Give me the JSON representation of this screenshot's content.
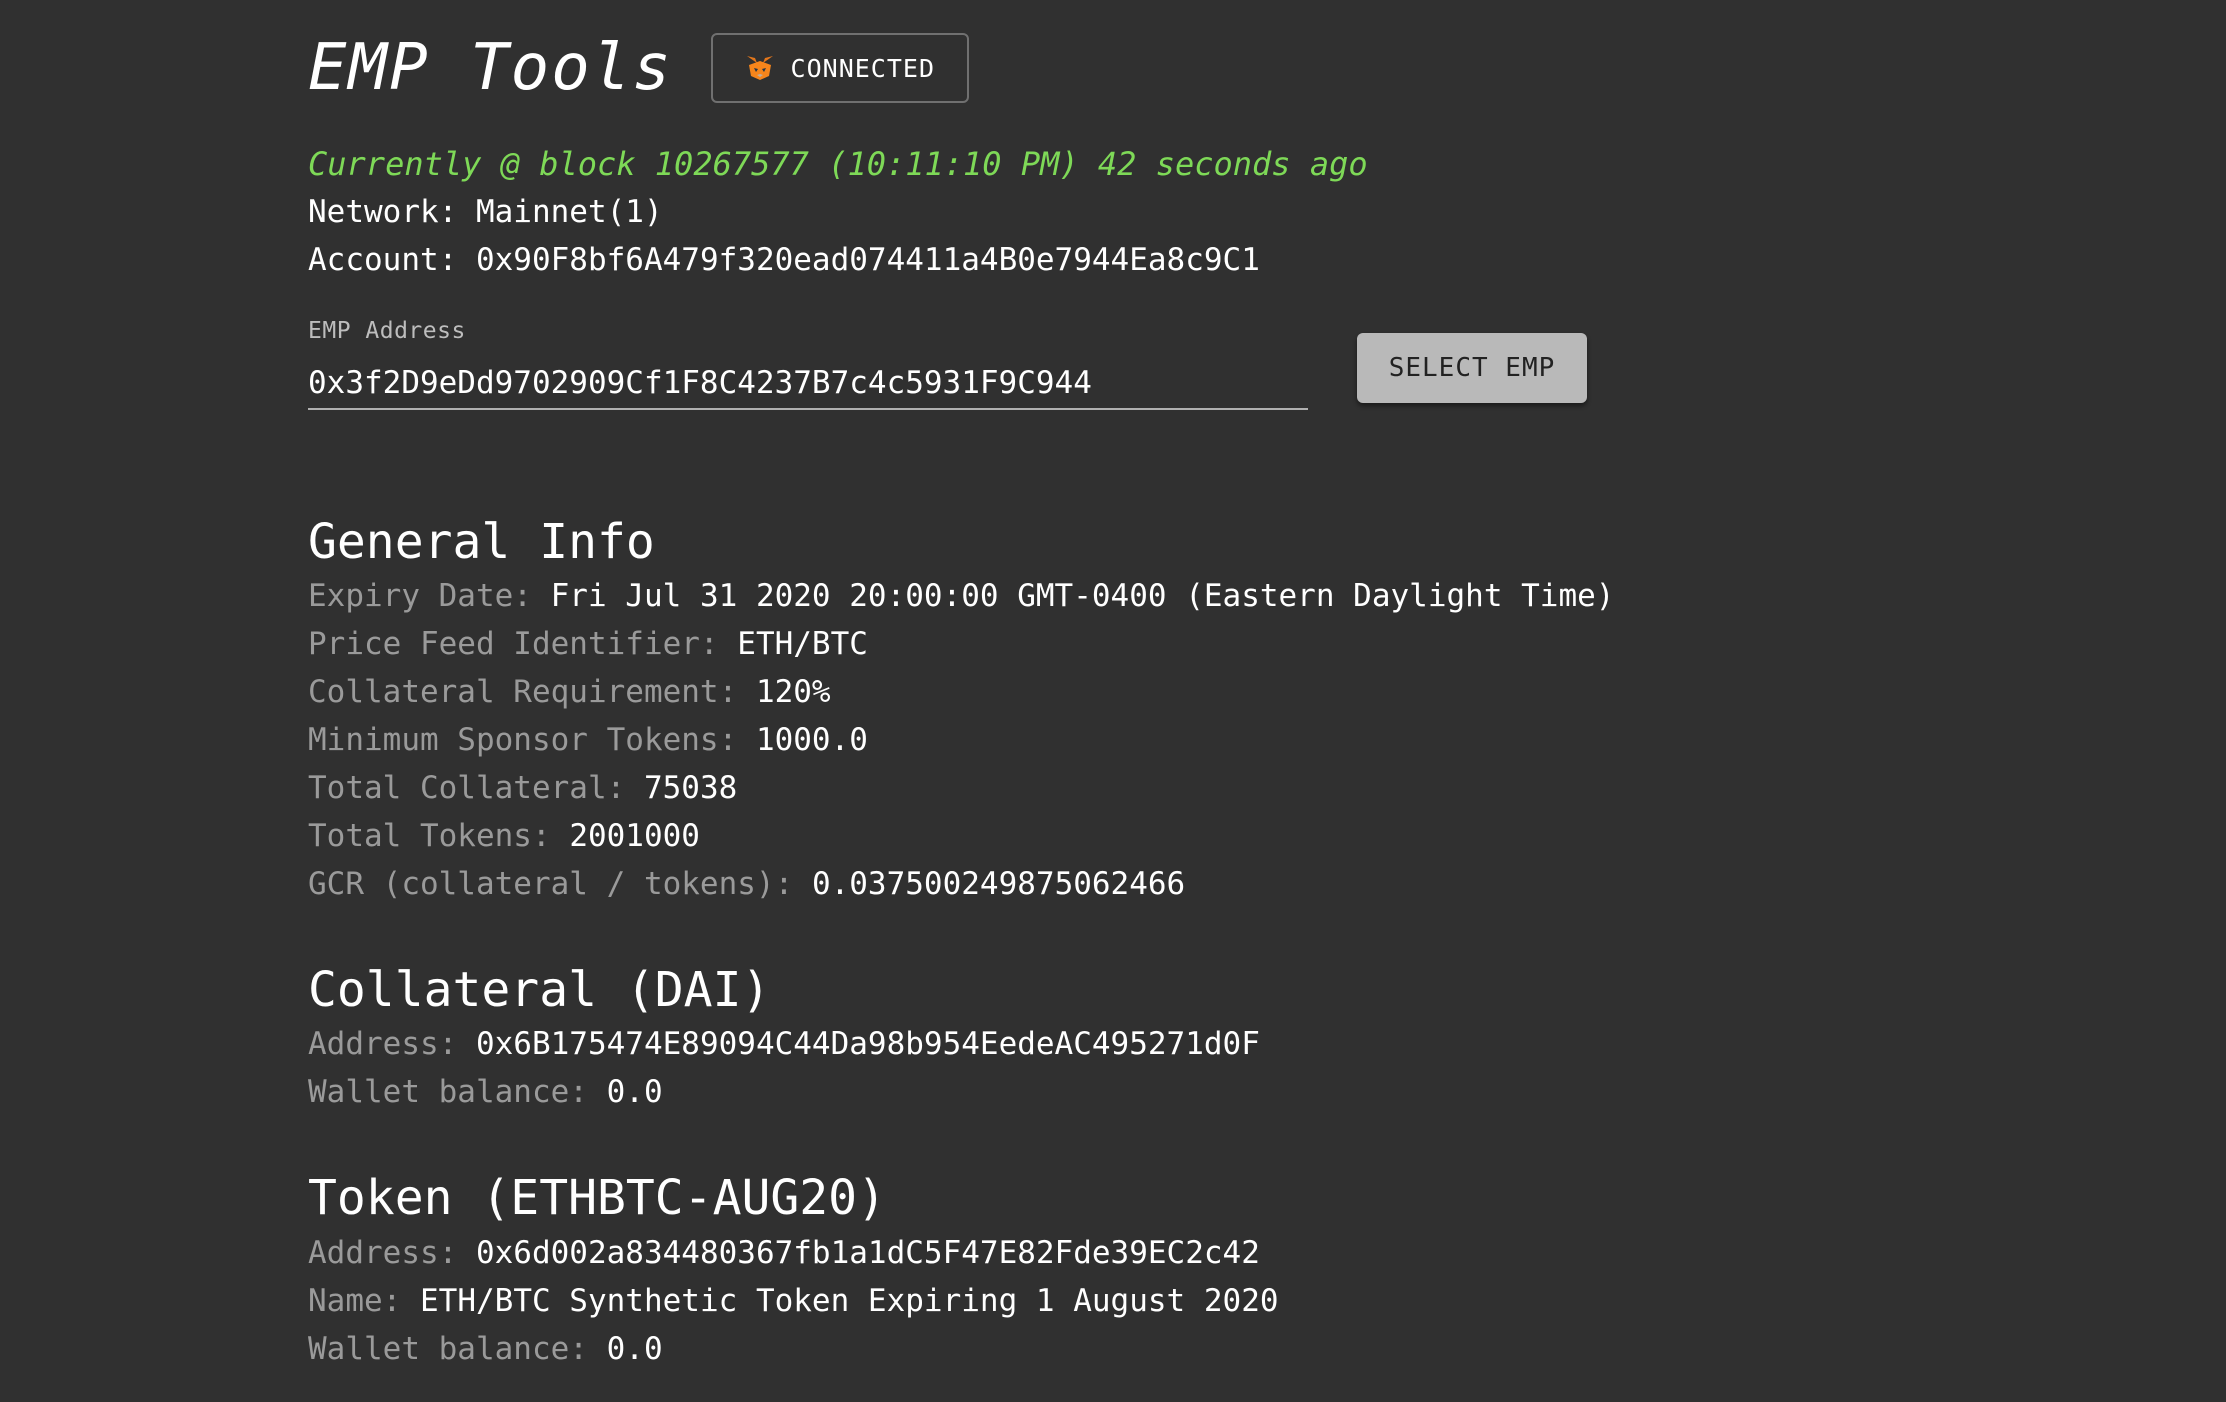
{
  "header": {
    "title": "EMP Tools",
    "connected_label": "CONNECTED"
  },
  "status": {
    "block_line": "Currently @ block 10267577 (10:11:10 PM) 42 seconds ago",
    "network_label": "Network:",
    "network_value": "Mainnet(1)",
    "account_label": "Account:",
    "account_value": "0x90F8bf6A479f320ead074411a4B0e7944Ea8c9C1"
  },
  "emp_selector": {
    "label": "EMP Address",
    "value": "0x3f2D9eDd9702909Cf1F8C4237B7c4c5931F9C944",
    "button_label": "SELECT EMP"
  },
  "general_info": {
    "heading": "General Info",
    "rows": [
      {
        "label": "Expiry Date:",
        "value": "Fri Jul 31 2020 20:00:00 GMT-0400 (Eastern Daylight Time)"
      },
      {
        "label": "Price Feed Identifier:",
        "value": "ETH/BTC"
      },
      {
        "label": "Collateral Requirement:",
        "value": "120%"
      },
      {
        "label": "Minimum Sponsor Tokens:",
        "value": "1000.0"
      },
      {
        "label": "Total Collateral:",
        "value": "75038"
      },
      {
        "label": "Total Tokens:",
        "value": "2001000"
      },
      {
        "label": "GCR (collateral / tokens):",
        "value": "0.037500249875062466"
      }
    ]
  },
  "collateral": {
    "heading": "Collateral (DAI)",
    "rows": [
      {
        "label": "Address:",
        "value": "0x6B175474E89094C44Da98b954EedeAC495271d0F"
      },
      {
        "label": "Wallet balance:",
        "value": "0.0"
      }
    ]
  },
  "token": {
    "heading": "Token (ETHBTC-AUG20)",
    "rows": [
      {
        "label": "Address:",
        "value": "0x6d002a834480367fb1a1dC5F47E82Fde39EC2c42"
      },
      {
        "label": "Name:",
        "value": "ETH/BTC Synthetic Token Expiring 1 August 2020"
      },
      {
        "label": "Wallet balance:",
        "value": "0.0"
      }
    ]
  },
  "colors": {
    "background": "#303030",
    "block_status": "#7ed957",
    "label_gray": "#9a9a9a",
    "button_bg": "#b9b9b9"
  },
  "icons": {
    "connected": "metamask-fox-icon"
  }
}
